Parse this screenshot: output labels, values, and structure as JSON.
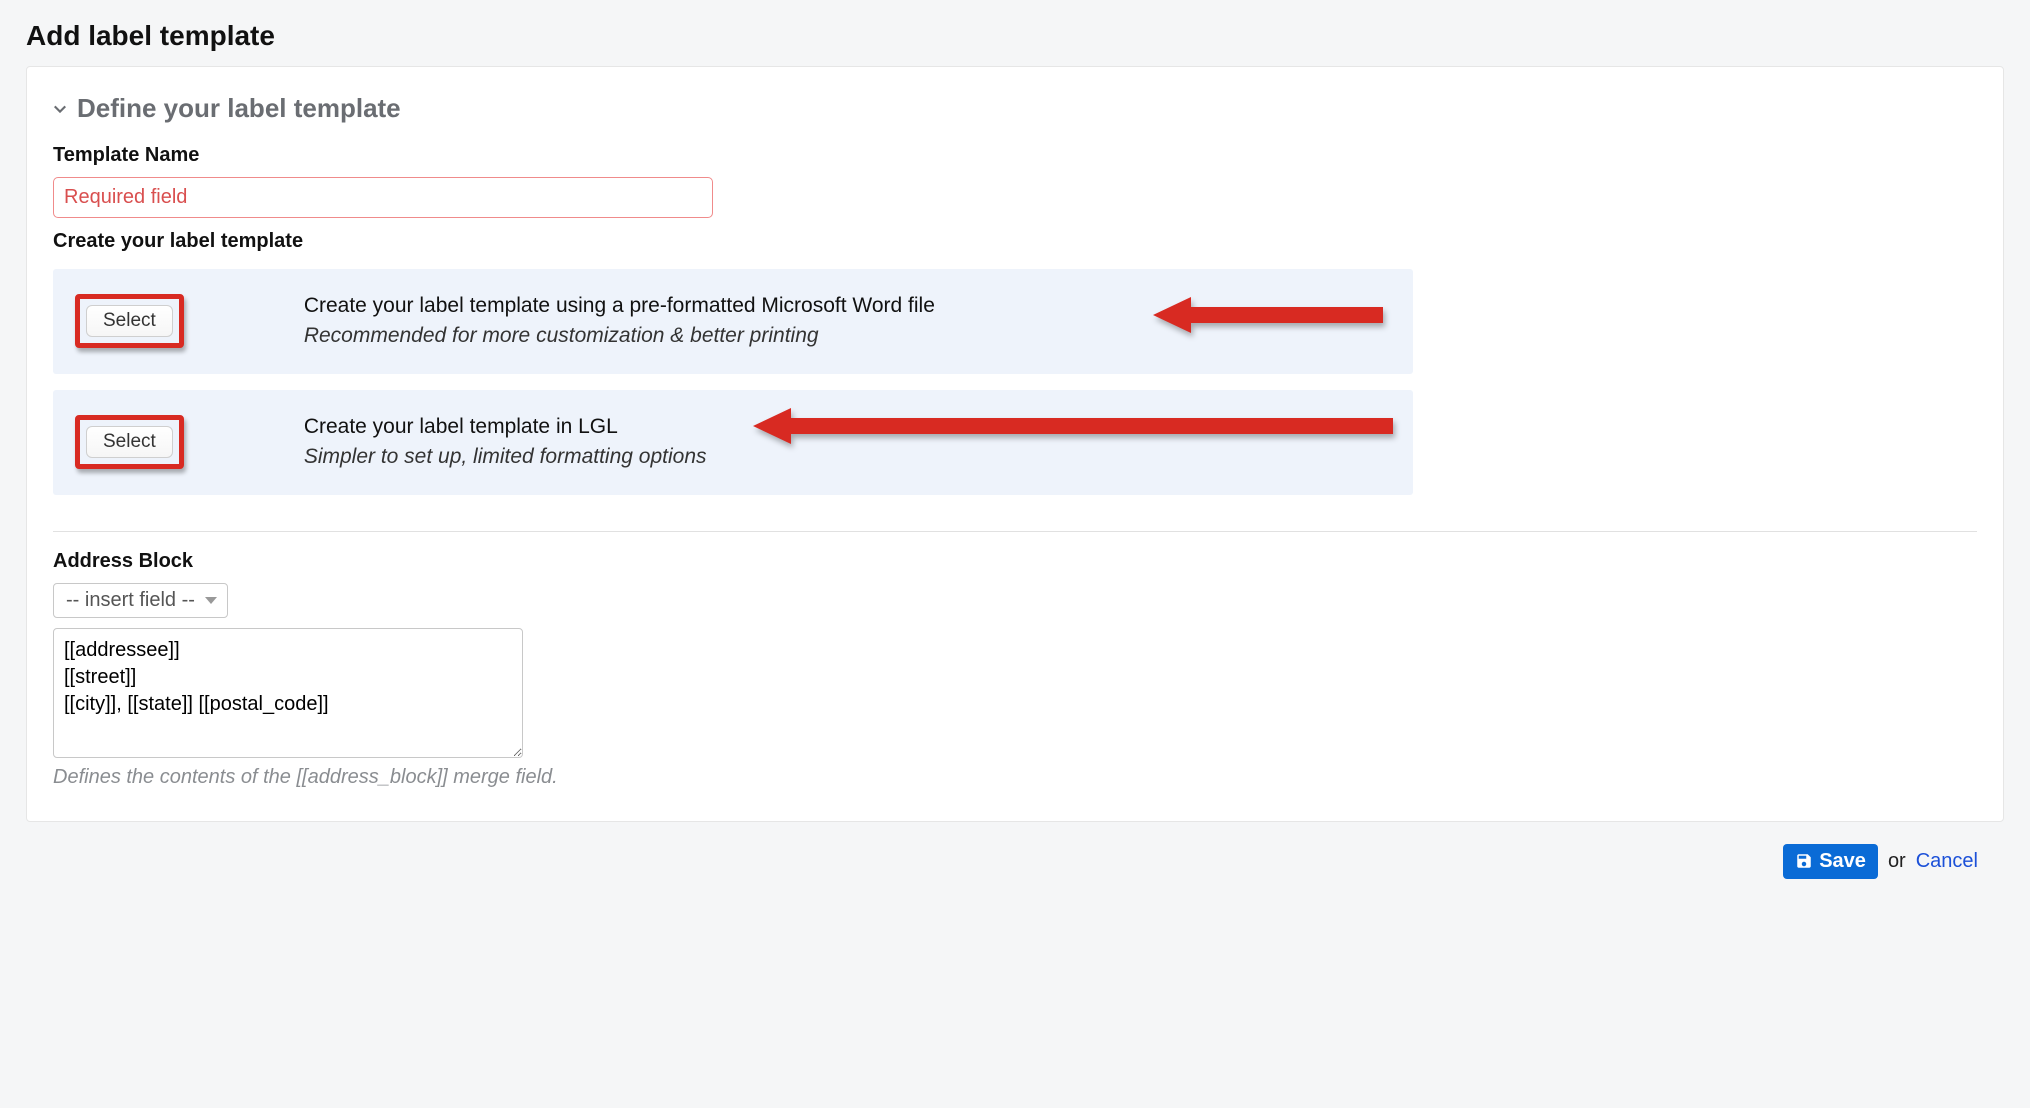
{
  "page": {
    "title": "Add label template"
  },
  "section": {
    "title": "Define your label template"
  },
  "template_name": {
    "label": "Template Name",
    "placeholder": "Required field",
    "value": ""
  },
  "create": {
    "label": "Create your label template",
    "options": [
      {
        "button": "Select",
        "title": "Create your label template using a pre-formatted Microsoft Word file",
        "subtitle": "Recommended for more customization & better printing"
      },
      {
        "button": "Select",
        "title": "Create your label template in LGL",
        "subtitle": "Simpler to set up, limited formatting options"
      }
    ]
  },
  "address_block": {
    "label": "Address Block",
    "insert_field": "-- insert field --",
    "value": "[[addressee]]\n[[street]]\n[[city]], [[state]] [[postal_code]]",
    "help": "Defines the contents of the [[address_block]] merge field."
  },
  "footer": {
    "save": "Save",
    "or": "or",
    "cancel": "Cancel"
  },
  "colors": {
    "accent_red": "#d82a22",
    "panel_blue": "#eef3fb",
    "primary_blue": "#0a6bd6"
  }
}
